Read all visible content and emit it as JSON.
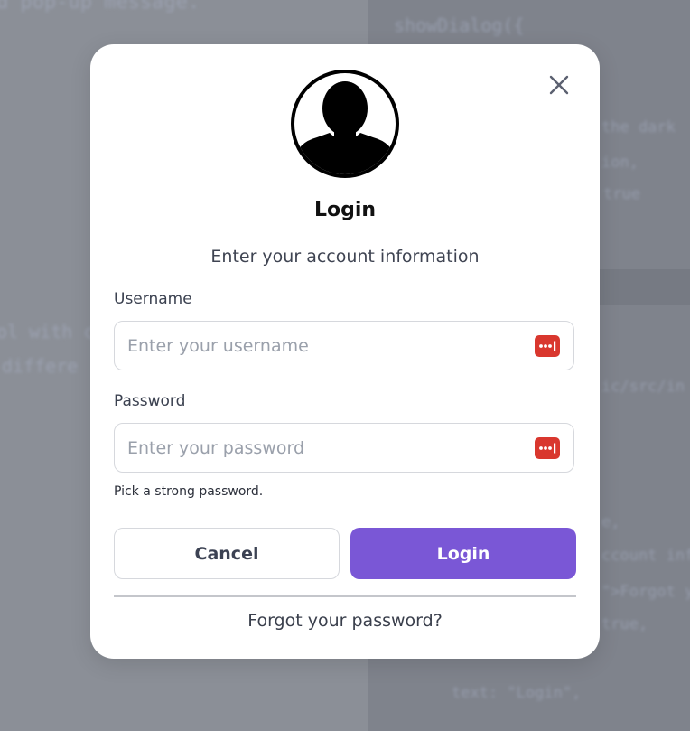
{
  "dialog": {
    "title": "Login",
    "subtitle": "Enter your account information",
    "close_icon": "close-icon",
    "avatar_icon": "user-avatar-icon"
  },
  "username": {
    "label": "Username",
    "placeholder": "Enter your username",
    "value": "",
    "icon": "password-manager-icon"
  },
  "password": {
    "label": "Password",
    "placeholder": "Enter your password",
    "value": "",
    "icon": "password-manager-icon",
    "hint": "Pick a strong password."
  },
  "actions": {
    "cancel_label": "Cancel",
    "login_label": "Login"
  },
  "forgot_link": "Forgot your password?",
  "background_code": {
    "line1": "d pop-up message.",
    "line2": "showDialog({",
    "line3": "the dark",
    "line4": "ion,",
    "line5": "true",
    "line6": "ol with c",
    "line7": "differe",
    "line8": "ic/src/in",
    "line9": "e,",
    "line10": "ccount inf",
    "line11": "\">Forgot y",
    "line12": "true,",
    "line13": "text: \"Login\","
  },
  "colors": {
    "accent": "#7a57d6",
    "password_icon": "#d9372e",
    "backdrop": "#8b8f97"
  }
}
